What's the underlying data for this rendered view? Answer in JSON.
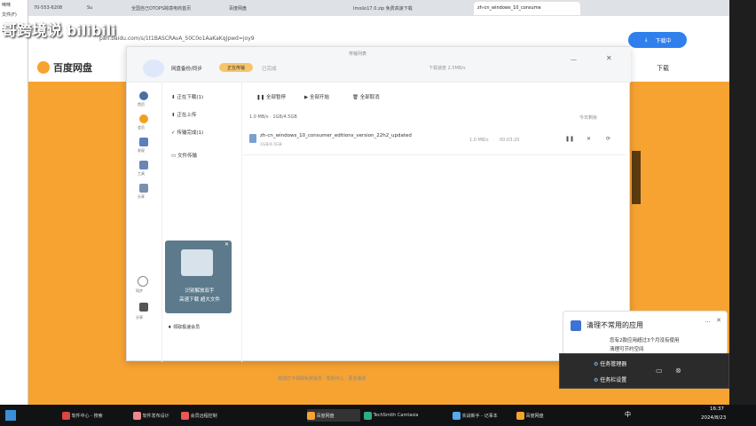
{
  "watermark": {
    "text": "哥跨境说",
    "brand": "bilibili"
  },
  "outer_left": {
    "label1": "咪咪",
    "label2": "文件(F)",
    "label3": "1"
  },
  "browser": {
    "tabs": [
      {
        "label": "70-553-6208"
      },
      {
        "label": "Su"
      },
      {
        "label": "全国自己OTOPS跨境电商首页"
      },
      {
        "label": "百度网盘"
      },
      {
        "label": "Imoiio17.0.zip 免费高速下载"
      },
      {
        "label": "zh-cn_windows_10_consume"
      }
    ],
    "url": "pan.baidu.com/s/1t1BASCRAvA_50C0o1AaKaKqJpwd=joy9",
    "download_button": "下载中",
    "right_link": "下载"
  },
  "baidu": {
    "logo": "百度网盘",
    "icons": [
      "首页",
      "会员",
      "发现",
      "工具",
      "分享"
    ]
  },
  "transfer": {
    "title": "传输列表",
    "tabs": [
      {
        "label": "网盘备份/同步"
      },
      {
        "label": "正在传输"
      },
      {
        "label": "已完成"
      }
    ],
    "stats": "下载速度 2.5MB/s",
    "sidebar": [
      {
        "label": "正在下载(1)"
      },
      {
        "label": "正在上传"
      },
      {
        "label": "传输完成(1)"
      },
      {
        "label": "文件传输"
      }
    ],
    "toolbar": [
      {
        "label": "全部暂停"
      },
      {
        "label": "全部开始"
      },
      {
        "label": "全部取消"
      }
    ],
    "section_label": "1.0 MB/s · 1GB/4.5GB",
    "section_right": "今日剩余",
    "file": {
      "name": "zh-cn_windows_10_consumer_editions_version_22h2_updated",
      "size": "1GB/4.5GB",
      "time": "00:03:20",
      "speed": "1.0 MB/s"
    },
    "promo": {
      "line1": "识别解放双手",
      "line2": "高速下载 超大文件"
    },
    "promo_footer": "领取极速会员",
    "bottom_icons": [
      "同步",
      "分享"
    ],
    "ad_footer": "完成打卡领取免费会员 · 帮助中心 · 更多服务"
  },
  "notification": {
    "title": "清理不常用的应用",
    "body1": "您有2款应用超过3个月没有使用",
    "body2": "清理可节约空间",
    "popup_items": [
      {
        "label": "任务管理器"
      },
      {
        "label": "任务栏设置"
      }
    ]
  },
  "tray": {
    "time": "16:37",
    "date": "2024/8/23",
    "ime": "中"
  },
  "taskbar": [
    {
      "label": "软件中心 - 搜索"
    },
    {
      "label": "软件发布设计"
    },
    {
      "label": "会员远程控制"
    },
    {
      "label": "百度网盘"
    },
    {
      "label": "TechSmith Camtasia"
    },
    {
      "label": "实战新手 - 记事本"
    },
    {
      "label": "百度网盘"
    }
  ]
}
